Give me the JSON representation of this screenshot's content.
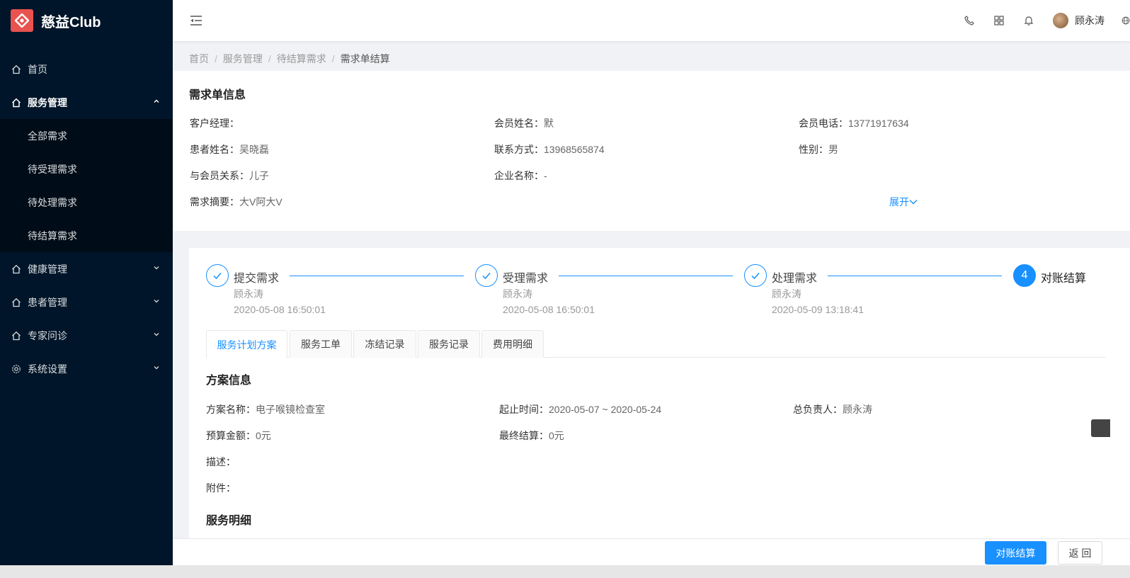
{
  "app": {
    "name": "慈益Club",
    "brand_color": "#e8534f",
    "accent": "#1890ff"
  },
  "sidebar": {
    "items": [
      {
        "label": "首页",
        "icon": "home-icon"
      },
      {
        "label": "服务管理",
        "icon": "home-icon",
        "expanded": true,
        "children": [
          "全部需求",
          "待受理需求",
          "待处理需求",
          "待结算需求"
        ]
      },
      {
        "label": "健康管理",
        "icon": "home-icon"
      },
      {
        "label": "患者管理",
        "icon": "home-icon"
      },
      {
        "label": "专家问诊",
        "icon": "home-icon"
      },
      {
        "label": "系统设置",
        "icon": "gear-icon"
      }
    ]
  },
  "header": {
    "username": "顾永涛"
  },
  "breadcrumb": [
    "首页",
    "服务管理",
    "待结算需求",
    "需求单结算"
  ],
  "order_info": {
    "title": "需求单信息",
    "fields": [
      {
        "label": "客户经理：",
        "value": ""
      },
      {
        "label": "会员姓名：",
        "value": "默"
      },
      {
        "label": "会员电话：",
        "value": "13771917634"
      },
      {
        "label": "患者姓名：",
        "value": "吴晓磊"
      },
      {
        "label": "联系方式：",
        "value": "13968565874"
      },
      {
        "label": "性别：",
        "value": "男"
      },
      {
        "label": "与会员关系：",
        "value": "儿子"
      },
      {
        "label": "企业名称：",
        "value": "-"
      },
      {
        "label": "需求摘要：",
        "value": "大V阿大V"
      }
    ],
    "expand_label": "展开"
  },
  "steps": [
    {
      "title": "提交需求",
      "person": "顾永涛",
      "time": "2020-05-08 16:50:01",
      "status": "done"
    },
    {
      "title": "受理需求",
      "person": "顾永涛",
      "time": "2020-05-08 16:50:01",
      "status": "done"
    },
    {
      "title": "处理需求",
      "person": "顾永涛",
      "time": "2020-05-09 13:18:41",
      "status": "done"
    },
    {
      "title": "对账结算",
      "number": "4",
      "status": "current"
    }
  ],
  "tabs": [
    "服务计划方案",
    "服务工单",
    "冻结记录",
    "服务记录",
    "费用明细"
  ],
  "plan": {
    "title": "方案信息",
    "fields": [
      {
        "label": "方案名称：",
        "value": "电子喉镜检查室"
      },
      {
        "label": "起止时间：",
        "value": "2020-05-07 ~ 2020-05-24"
      },
      {
        "label": "总负责人：",
        "value": "顾永涛"
      },
      {
        "label": "预算金额：",
        "value": "0元"
      },
      {
        "label": "最终结算：",
        "value": "0元"
      },
      {
        "label": "描述：",
        "value": ""
      },
      {
        "label": "附件：",
        "value": ""
      }
    ]
  },
  "service_detail_title": "服务明细",
  "footer": {
    "settle_label": "对账结算",
    "back_label": "返 回"
  }
}
